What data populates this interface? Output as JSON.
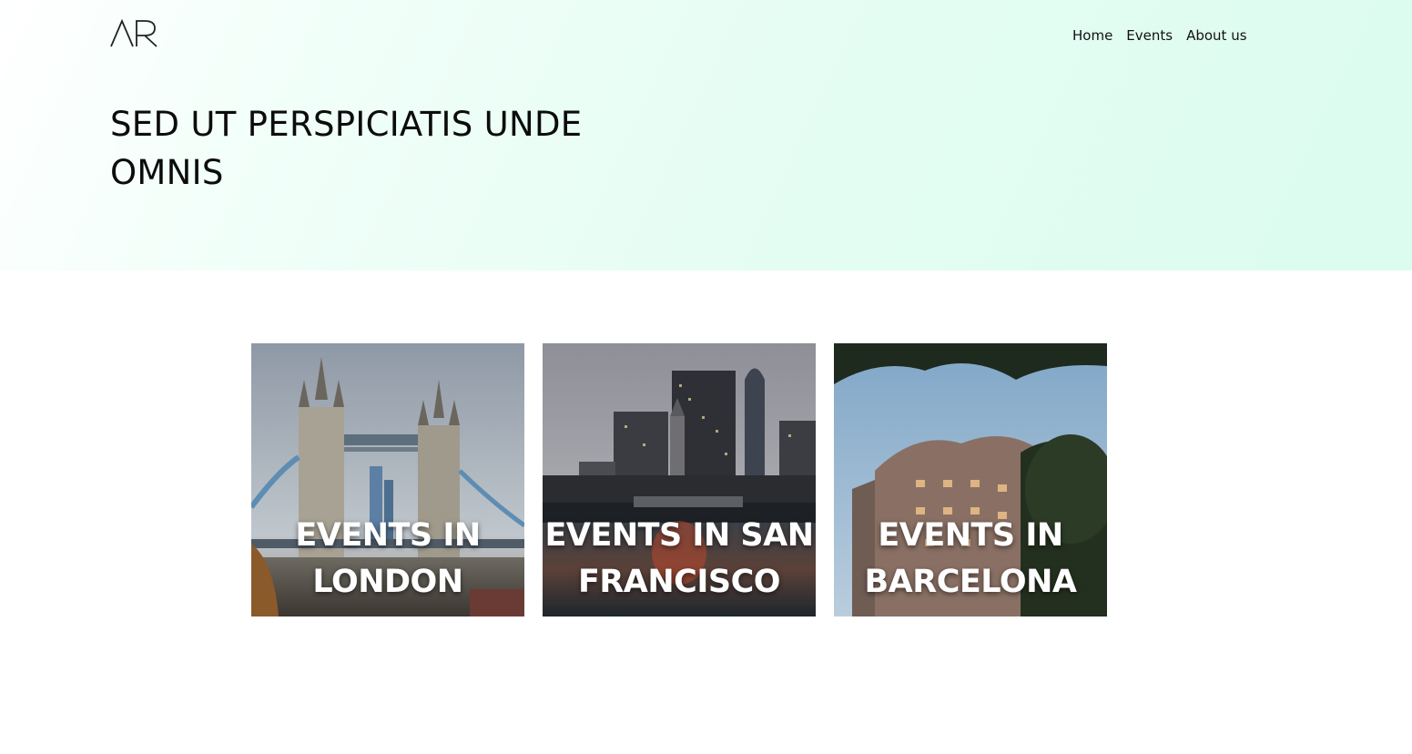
{
  "header": {
    "logo_text": "AR",
    "nav": [
      {
        "label": "Home"
      },
      {
        "label": "Events"
      },
      {
        "label": "About us"
      }
    ]
  },
  "hero": {
    "title": "SED UT PERSPICIATIS UNDE OMNIS"
  },
  "cards": [
    {
      "title_line1": "EVENTS IN",
      "title_line2": "LONDON",
      "image": "tower-bridge-photo"
    },
    {
      "title_line1": "EVENTS IN SAN",
      "title_line2": "FRANCISCO",
      "image": "san-francisco-ferry-building-photo"
    },
    {
      "title_line1": "EVENTS IN",
      "title_line2": "BARCELONA",
      "image": "casa-batllo-photo"
    }
  ]
}
